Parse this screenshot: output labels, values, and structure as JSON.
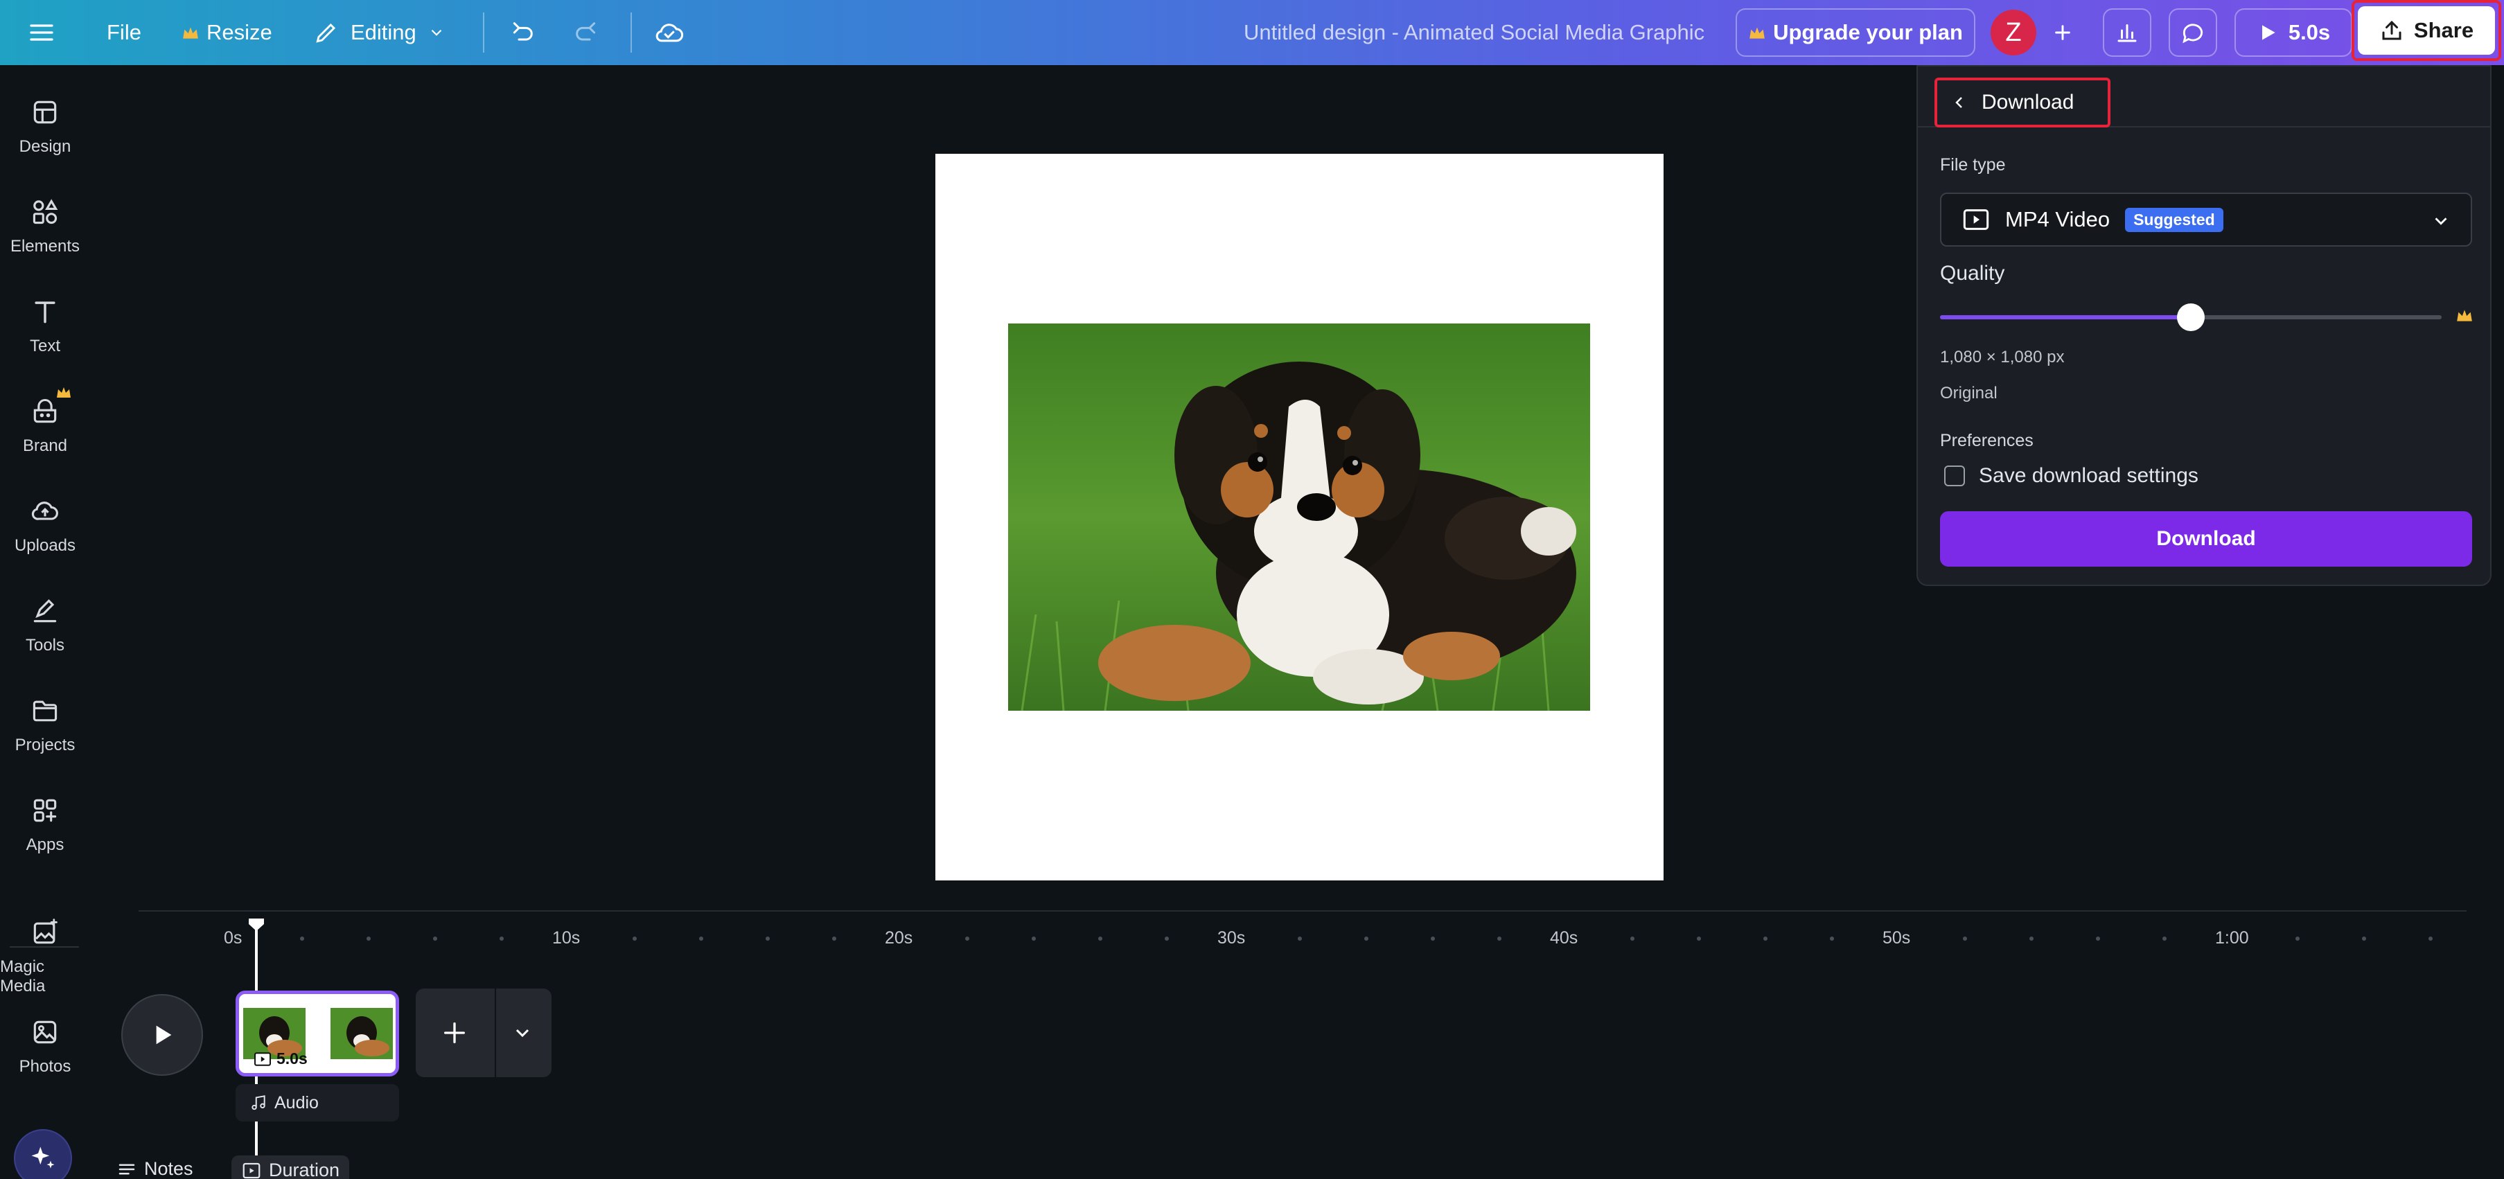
{
  "topbar": {
    "file_label": "File",
    "resize_label": "Resize",
    "editing_label": "Editing",
    "design_title": "Untitled design - Animated Social Media Graphic",
    "upgrade_label": "Upgrade your plan",
    "avatar_initial": "Z",
    "play_duration": "5.0s",
    "share_label": "Share"
  },
  "sidebar": {
    "items": [
      {
        "label": "Design",
        "icon": "layout-icon"
      },
      {
        "label": "Elements",
        "icon": "shapes-icon"
      },
      {
        "label": "Text",
        "icon": "text-icon"
      },
      {
        "label": "Brand",
        "icon": "brand-icon"
      },
      {
        "label": "Uploads",
        "icon": "cloud-upload-icon"
      },
      {
        "label": "Tools",
        "icon": "pen-icon"
      },
      {
        "label": "Projects",
        "icon": "folder-icon"
      },
      {
        "label": "Apps",
        "icon": "apps-icon"
      },
      {
        "label": "Magic Media",
        "icon": "magic-media-icon"
      },
      {
        "label": "Photos",
        "icon": "photo-icon"
      }
    ]
  },
  "download_panel": {
    "title": "Download",
    "file_type_label": "File type",
    "file_type_value": "MP4 Video",
    "file_type_badge": "Suggested",
    "quality_label": "Quality",
    "quality_fraction": 0.5,
    "dimensions": "1,080 × 1,080 px",
    "size_preset": "Original",
    "preferences_label": "Preferences",
    "save_settings_label": "Save download settings",
    "save_settings_checked": false,
    "download_button": "Download"
  },
  "timeline": {
    "ticks": [
      "0s",
      "10s",
      "20s",
      "30s",
      "40s",
      "50s",
      "1:00"
    ],
    "clip_duration": "5.0s",
    "audio_label": "Audio"
  },
  "bottombar": {
    "notes_label": "Notes",
    "duration_label": "Duration"
  },
  "colors": {
    "accent_purple": "#7d2ae8",
    "highlight_red": "#e5243c",
    "badge_blue": "#3b6ef0"
  }
}
